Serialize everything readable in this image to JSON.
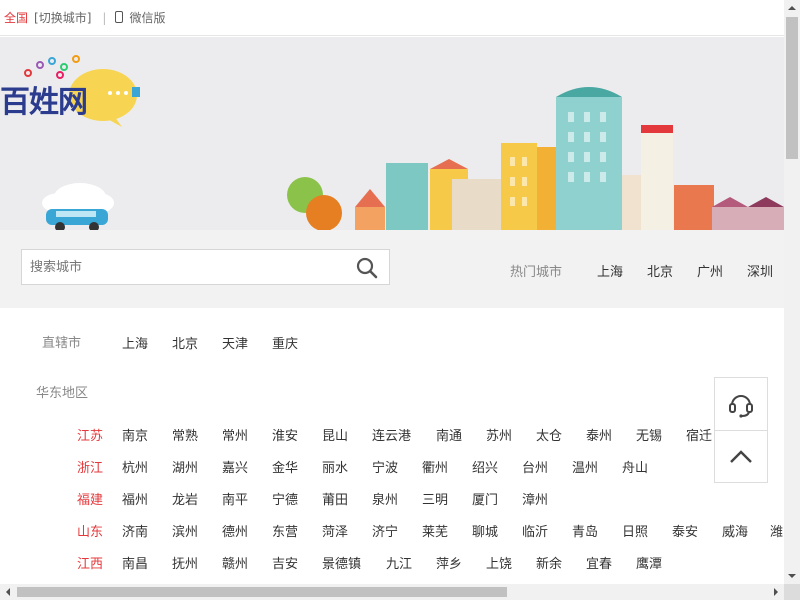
{
  "topbar": {
    "current_city": "全国",
    "switch_label": "[切换城市]",
    "separator": "|",
    "wechat_label": "微信版"
  },
  "logo": {
    "text": "百姓网"
  },
  "search": {
    "placeholder": "搜索城市",
    "hot_label": "热门城市",
    "hot_cities": [
      "上海",
      "北京",
      "广州",
      "深圳"
    ]
  },
  "municipalities": {
    "title": "直辖市",
    "cities": [
      "上海",
      "北京",
      "天津",
      "重庆"
    ]
  },
  "east_china": {
    "title": "华东地区",
    "provinces": [
      {
        "name": "江苏",
        "cities": [
          "南京",
          "常熟",
          "常州",
          "淮安",
          "昆山",
          "连云港",
          "南通",
          "苏州",
          "太仓",
          "泰州",
          "无锡",
          "宿迁"
        ]
      },
      {
        "name": "浙江",
        "cities": [
          "杭州",
          "湖州",
          "嘉兴",
          "金华",
          "丽水",
          "宁波",
          "衢州",
          "绍兴",
          "台州",
          "温州",
          "舟山"
        ]
      },
      {
        "name": "福建",
        "cities": [
          "福州",
          "龙岩",
          "南平",
          "宁德",
          "莆田",
          "泉州",
          "三明",
          "厦门",
          "漳州"
        ]
      },
      {
        "name": "山东",
        "cities": [
          "济南",
          "滨州",
          "德州",
          "东营",
          "菏泽",
          "济宁",
          "莱芜",
          "聊城",
          "临沂",
          "青岛",
          "日照",
          "泰安",
          "威海",
          "潍"
        ]
      },
      {
        "name": "江西",
        "cities": [
          "南昌",
          "抚州",
          "赣州",
          "吉安",
          "景德镇",
          "九江",
          "萍乡",
          "上饶",
          "新余",
          "宜春",
          "鹰潭"
        ]
      }
    ]
  },
  "colors": {
    "accent": "#e4393c",
    "logo": "#2b3c8f",
    "banner_bg": "#ececee"
  },
  "icons": [
    "phone-icon",
    "search-icon",
    "customer-service-icon",
    "chevron-up-icon"
  ]
}
